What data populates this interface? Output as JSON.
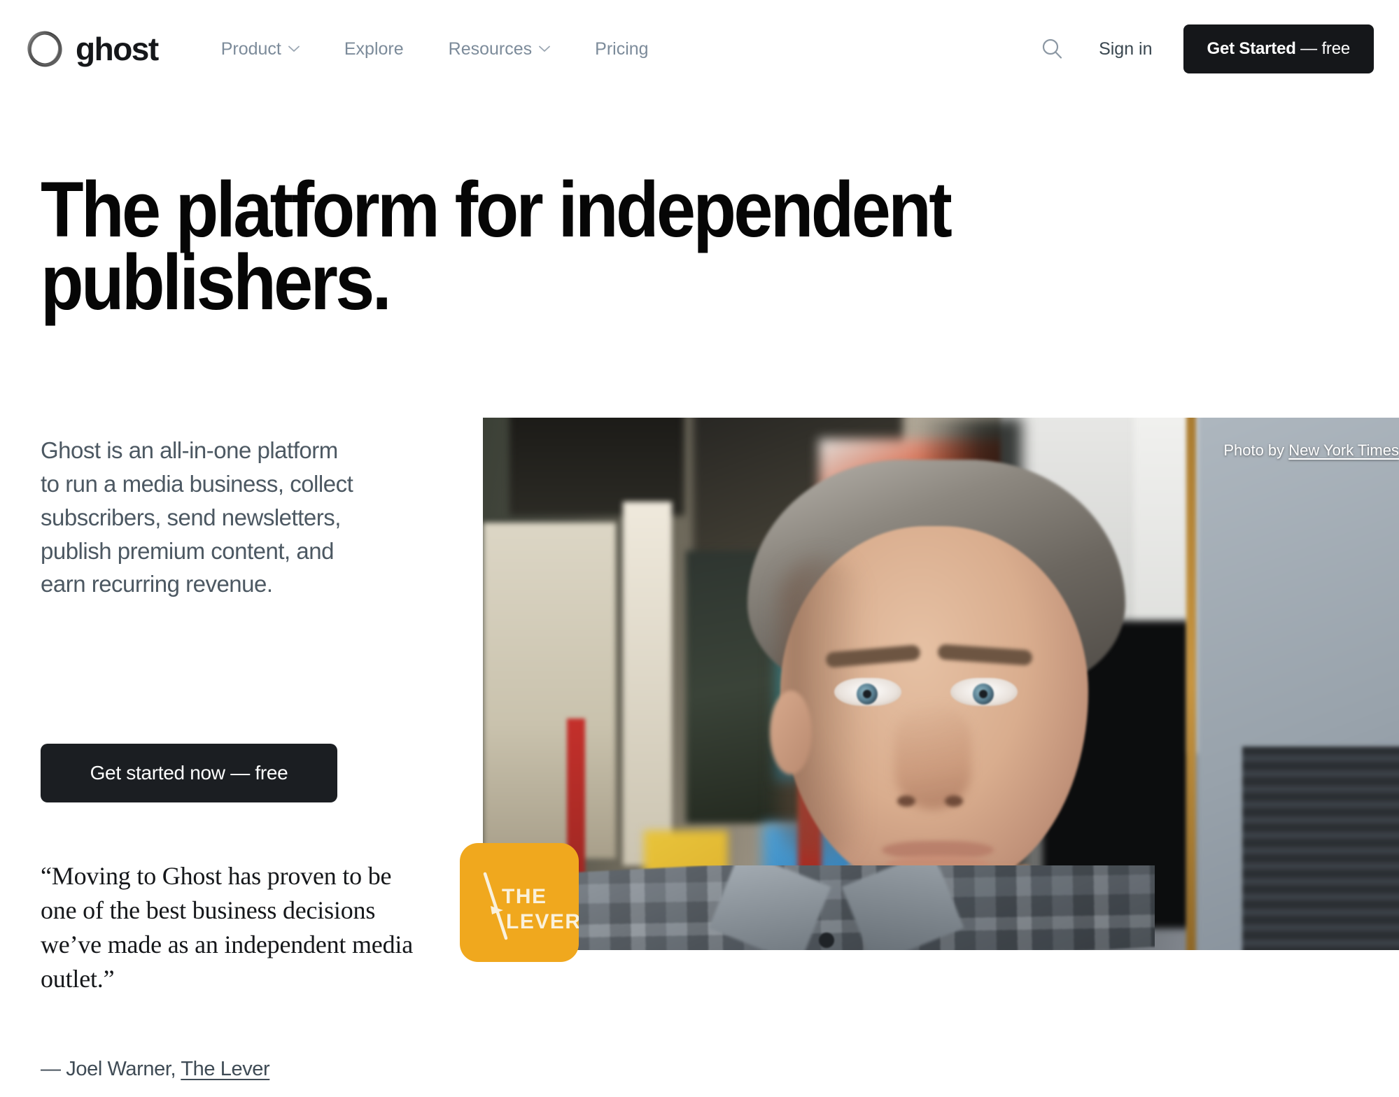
{
  "brand": {
    "name": "ghost",
    "logo_icon": "ghost-ring-logo"
  },
  "nav": {
    "items": [
      {
        "label": "Product",
        "has_dropdown": true,
        "icon": "chevron-down-icon"
      },
      {
        "label": "Explore",
        "has_dropdown": false,
        "icon": ""
      },
      {
        "label": "Resources",
        "has_dropdown": true,
        "icon": "chevron-down-icon"
      },
      {
        "label": "Pricing",
        "has_dropdown": false,
        "icon": ""
      }
    ]
  },
  "header_actions": {
    "search_icon": "search-icon",
    "sign_in_label": "Sign in",
    "cta_label_bold": "Get Started",
    "cta_label_rest": " — free"
  },
  "hero": {
    "title": "The platform for independent publishers.",
    "body": "Ghost is an all-in-one platform to run a media business, collect subscribers, send newsletters, publish premium content, and earn recurring revenue.",
    "cta_label": "Get started now — free"
  },
  "quote": {
    "text": "“Moving to Ghost has proven to be one of the best business decisions we’ve made as an independent media outlet.”",
    "attribution_dash": "— ",
    "attribution_name": "Joel Warner, ",
    "attribution_source": "The Lever"
  },
  "photo": {
    "credit_prefix": "Photo by ",
    "credit_source": "New York Times",
    "alt": "Portrait of a grey-haired man in a grey plaid shirt in front of a wall of colourful art posters and printed documents"
  },
  "lever_badge": {
    "line1": "THE",
    "line2": "LEVER",
    "background_color": "#F0A81E",
    "text_color": "#FAF1DC"
  },
  "colors": {
    "page_background": "#FFFFFF",
    "text_primary": "#15171A",
    "text_muted": "#7C8B9A",
    "body_text": "#4C5862",
    "button_dark": "#1B1E22",
    "accent_amber": "#F0A81E"
  }
}
